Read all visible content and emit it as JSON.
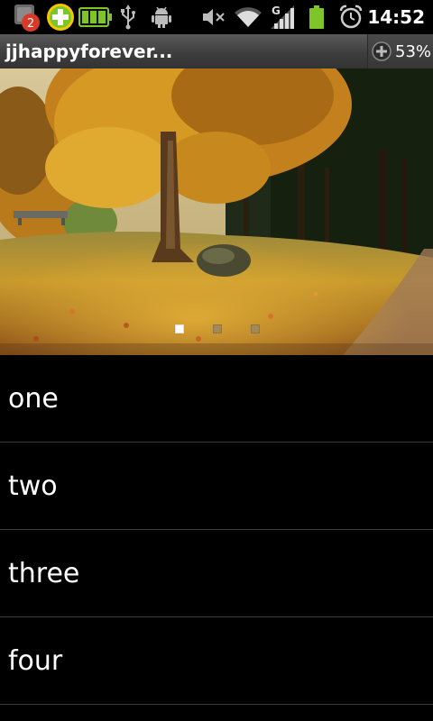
{
  "status_bar": {
    "notification_count": "2",
    "clock": "14:52",
    "icons": [
      "notification-badge-icon",
      "add-app-icon",
      "battery-app-icon",
      "usb-icon",
      "android-debug-icon",
      "mute-icon",
      "wifi-icon",
      "signal-icon",
      "battery-icon",
      "alarm-icon"
    ],
    "network_type": "G"
  },
  "title_bar": {
    "title": "jjhappyforever...",
    "zoom_percent": "53%"
  },
  "banner": {
    "pages": 3,
    "active_page": 1
  },
  "list": {
    "items": [
      {
        "label": "one"
      },
      {
        "label": "two"
      },
      {
        "label": "three"
      },
      {
        "label": "four"
      }
    ]
  },
  "colors": {
    "background": "#000000",
    "title_bar": "#3e3e3e",
    "divider": "#3b3b3b",
    "battery_green": "#7ec627"
  }
}
